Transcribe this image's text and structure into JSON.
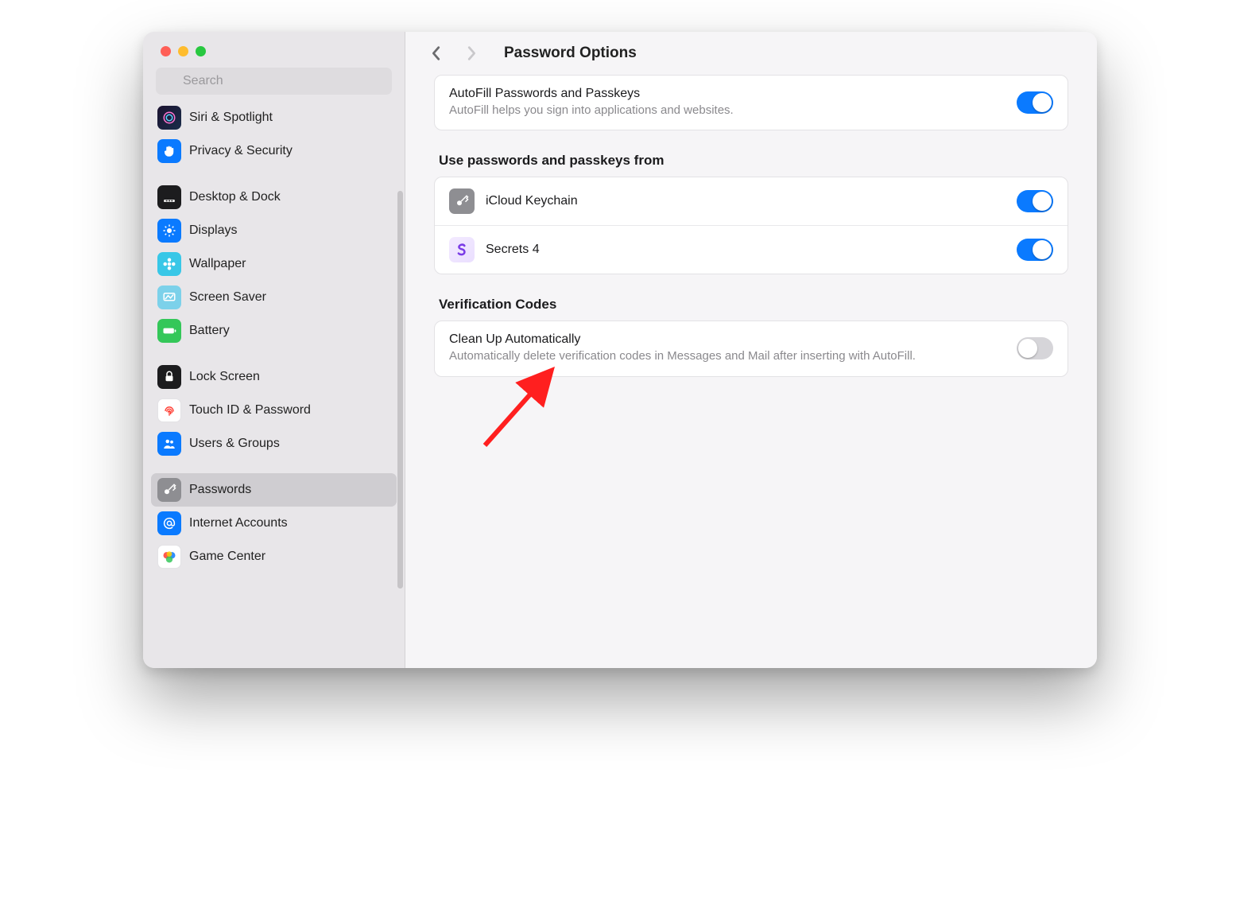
{
  "search": {
    "placeholder": "Search"
  },
  "sidebar": {
    "items": [
      {
        "label": "Siri & Spotlight"
      },
      {
        "label": "Privacy & Security"
      },
      {
        "label": "Desktop & Dock"
      },
      {
        "label": "Displays"
      },
      {
        "label": "Wallpaper"
      },
      {
        "label": "Screen Saver"
      },
      {
        "label": "Battery"
      },
      {
        "label": "Lock Screen"
      },
      {
        "label": "Touch ID & Password"
      },
      {
        "label": "Users & Groups"
      },
      {
        "label": "Passwords"
      },
      {
        "label": "Internet Accounts"
      },
      {
        "label": "Game Center"
      }
    ]
  },
  "header": {
    "title": "Password Options"
  },
  "main": {
    "autofill": {
      "title": "AutoFill Passwords and Passkeys",
      "subtitle": "AutoFill helps you sign into applications and websites.",
      "on": true
    },
    "providers_label": "Use passwords and passkeys from",
    "providers": [
      {
        "name": "iCloud Keychain",
        "on": true
      },
      {
        "name": "Secrets 4",
        "on": true
      }
    ],
    "verification_label": "Verification Codes",
    "cleanup": {
      "title": "Clean Up Automatically",
      "subtitle": "Automatically delete verification codes in Messages and Mail after inserting with AutoFill.",
      "on": false
    }
  }
}
